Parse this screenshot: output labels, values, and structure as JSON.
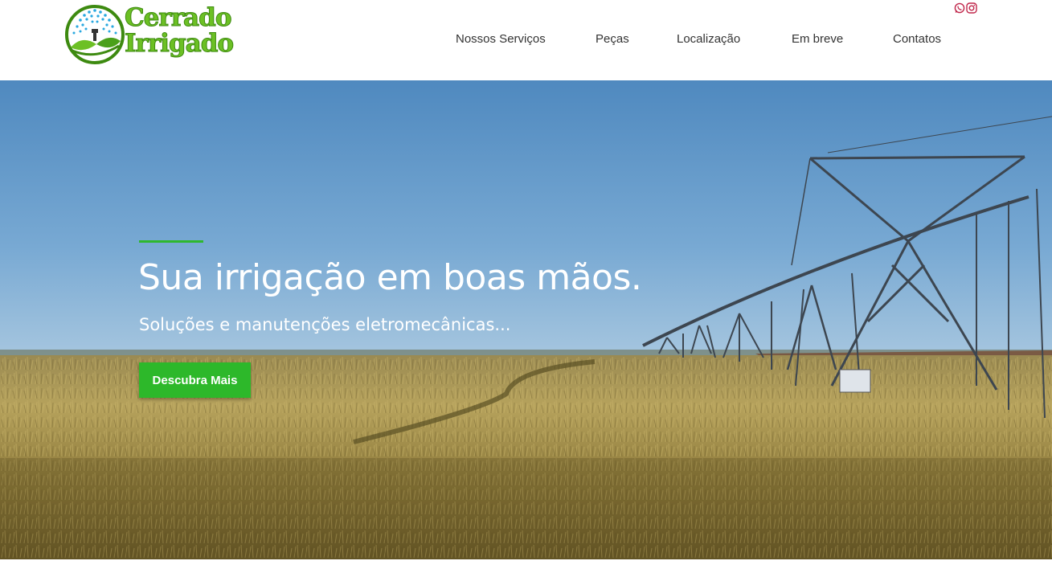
{
  "brand": {
    "logo_line1": "Cerrado",
    "logo_line2": "Irrigado",
    "primary_green": "#2db82a",
    "logo_green": "#6cc024",
    "logo_blue": "#29a8e0"
  },
  "nav": {
    "items": [
      {
        "label": "Nossos Serviços"
      },
      {
        "label": "Peças"
      },
      {
        "label": "Localização"
      },
      {
        "label": "Em breve"
      },
      {
        "label": "Contatos"
      }
    ]
  },
  "social": {
    "icons": [
      "whatsapp-icon",
      "instagram-icon"
    ],
    "color": "#c0264a"
  },
  "hero": {
    "title": "Sua irrigação em boas mãos.",
    "subtitle": "Soluções e manutenções eletromecânicas...",
    "cta_label": "Descubra Mais",
    "sky_color": "#5b93c4",
    "field_color": "#a89048"
  }
}
